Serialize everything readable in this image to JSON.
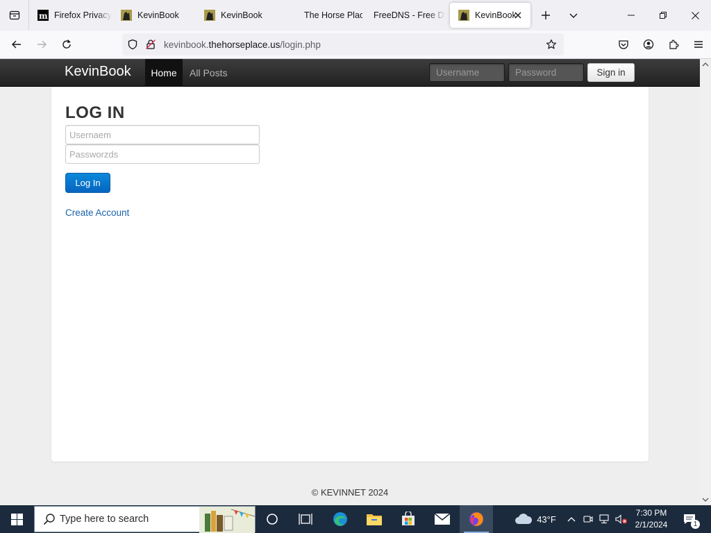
{
  "browser": {
    "tabs": [
      {
        "title": "Firefox Privacy",
        "favicon": "mozilla-m-icon"
      },
      {
        "title": "KevinBook",
        "favicon": "kevinbook-icon"
      },
      {
        "title": "KevinBook",
        "favicon": "kevinbook-icon"
      },
      {
        "title": "The Horse Place",
        "favicon": ""
      },
      {
        "title": "FreeDNS - Free DNS",
        "favicon": ""
      },
      {
        "title": "KevinBook",
        "favicon": "kevinbook-icon",
        "active": true
      }
    ],
    "url_prefix": "kevinbook.",
    "url_domain": "thehorseplace.us",
    "url_path": "/login.php"
  },
  "site": {
    "brand": "KevinBook",
    "nav_home": "Home",
    "nav_posts": "All Posts",
    "username_placeholder": "Username",
    "password_placeholder": "Password",
    "signin_label": "Sign in",
    "footer": "© KEVINNET 2024"
  },
  "login": {
    "title": "LOG IN",
    "username_placeholder": "Usernaem",
    "password_placeholder": "Passworzds",
    "button_label": "Log In",
    "create_account": "Create Account"
  },
  "taskbar": {
    "search_placeholder": "Type here to search",
    "weather": "43°F",
    "time": "7:30 PM",
    "date": "2/1/2024",
    "notification_count": "1"
  },
  "colors": {
    "accent_button": "#0b7bd1",
    "link": "#1a64a8",
    "site_nav": "#2b2b2b",
    "taskbar": "#1c2a3d"
  }
}
